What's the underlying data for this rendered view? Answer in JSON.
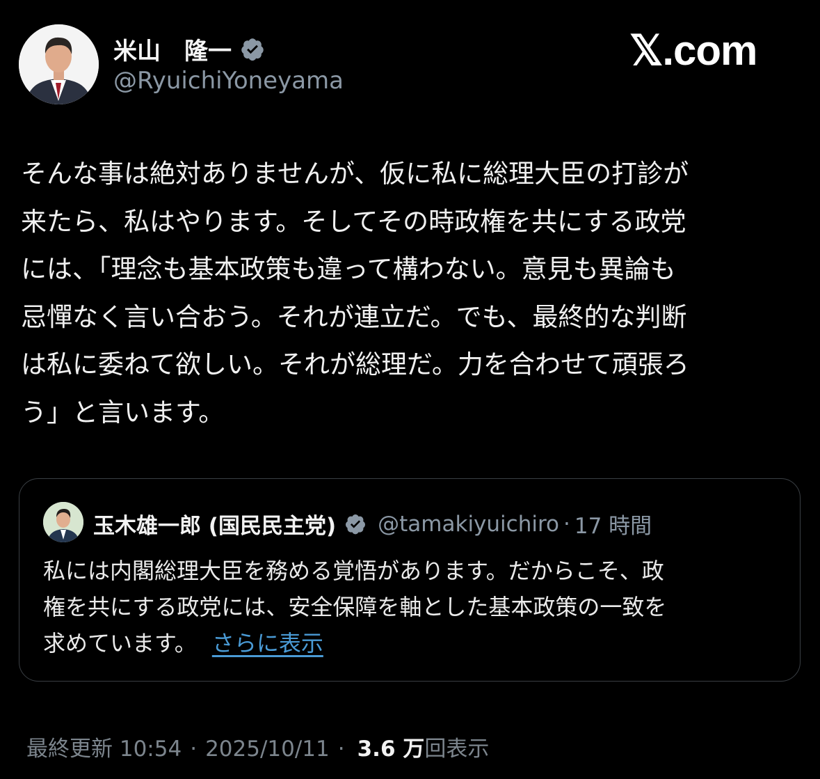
{
  "author": {
    "display_name": "米山　隆一",
    "handle": "@RyuichiYoneyama",
    "verified_icon": "verified-badge-icon"
  },
  "brand": {
    "logo_text": "𝕏.com"
  },
  "tweet": {
    "text": "そんな事は絶対ありませんが、仮に私に総理大臣の打診が\n来たら、私はやります。そしてその時政権を共にする政党\nには、「理念も基本政策も違って構わない。意見も異論も\n忌憚なく言い合おう。それが連立だ。でも、最終的な判断\nは私に委ねて欲しい。それが総理だ。力を合わせて頑張ろ\nう」と言います。"
  },
  "quote": {
    "name": "玉木雄一郎 (国民民主党)",
    "handle": "@tamakiyuichiro",
    "dot": "·",
    "time": "17 時間",
    "text": "私には内閣総理大臣を務める覚悟があります。だからこそ、政\n権を共にする政党には、安全保障を軸とした基本政策の一致を\n求めています。",
    "show_more": "さらに表示"
  },
  "meta": {
    "updated_label": "最終更新 10:54",
    "sep1": "·",
    "date": "2025/10/11",
    "sep2": "·",
    "views_count": "3.6 万",
    "views_label": "回表示"
  },
  "colors": {
    "background": "#000000",
    "text": "#e7e9ea",
    "muted": "#8b98a5",
    "link": "#4a9bd6",
    "verified": "#8b98a5"
  }
}
